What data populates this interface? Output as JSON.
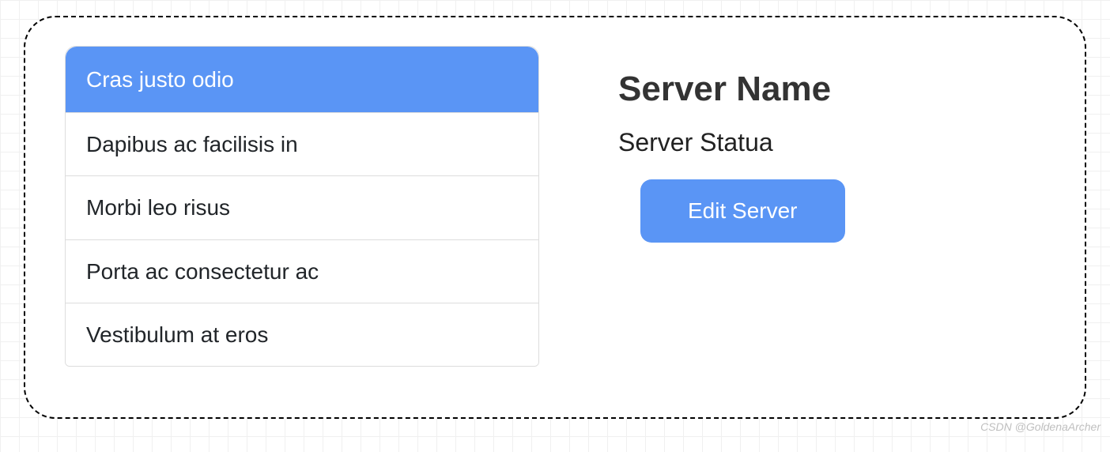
{
  "list": {
    "items": [
      {
        "label": "Cras justo odio",
        "active": true
      },
      {
        "label": "Dapibus ac facilisis in",
        "active": false
      },
      {
        "label": "Morbi leo risus",
        "active": false
      },
      {
        "label": "Porta ac consectetur ac",
        "active": false
      },
      {
        "label": "Vestibulum at eros",
        "active": false
      }
    ]
  },
  "detail": {
    "title": "Server Name",
    "status_label": "Server Statua",
    "edit_button_label": "Edit Server"
  },
  "watermark": "CSDN @GoldenaArcher",
  "colors": {
    "primary": "#5a95f5"
  }
}
